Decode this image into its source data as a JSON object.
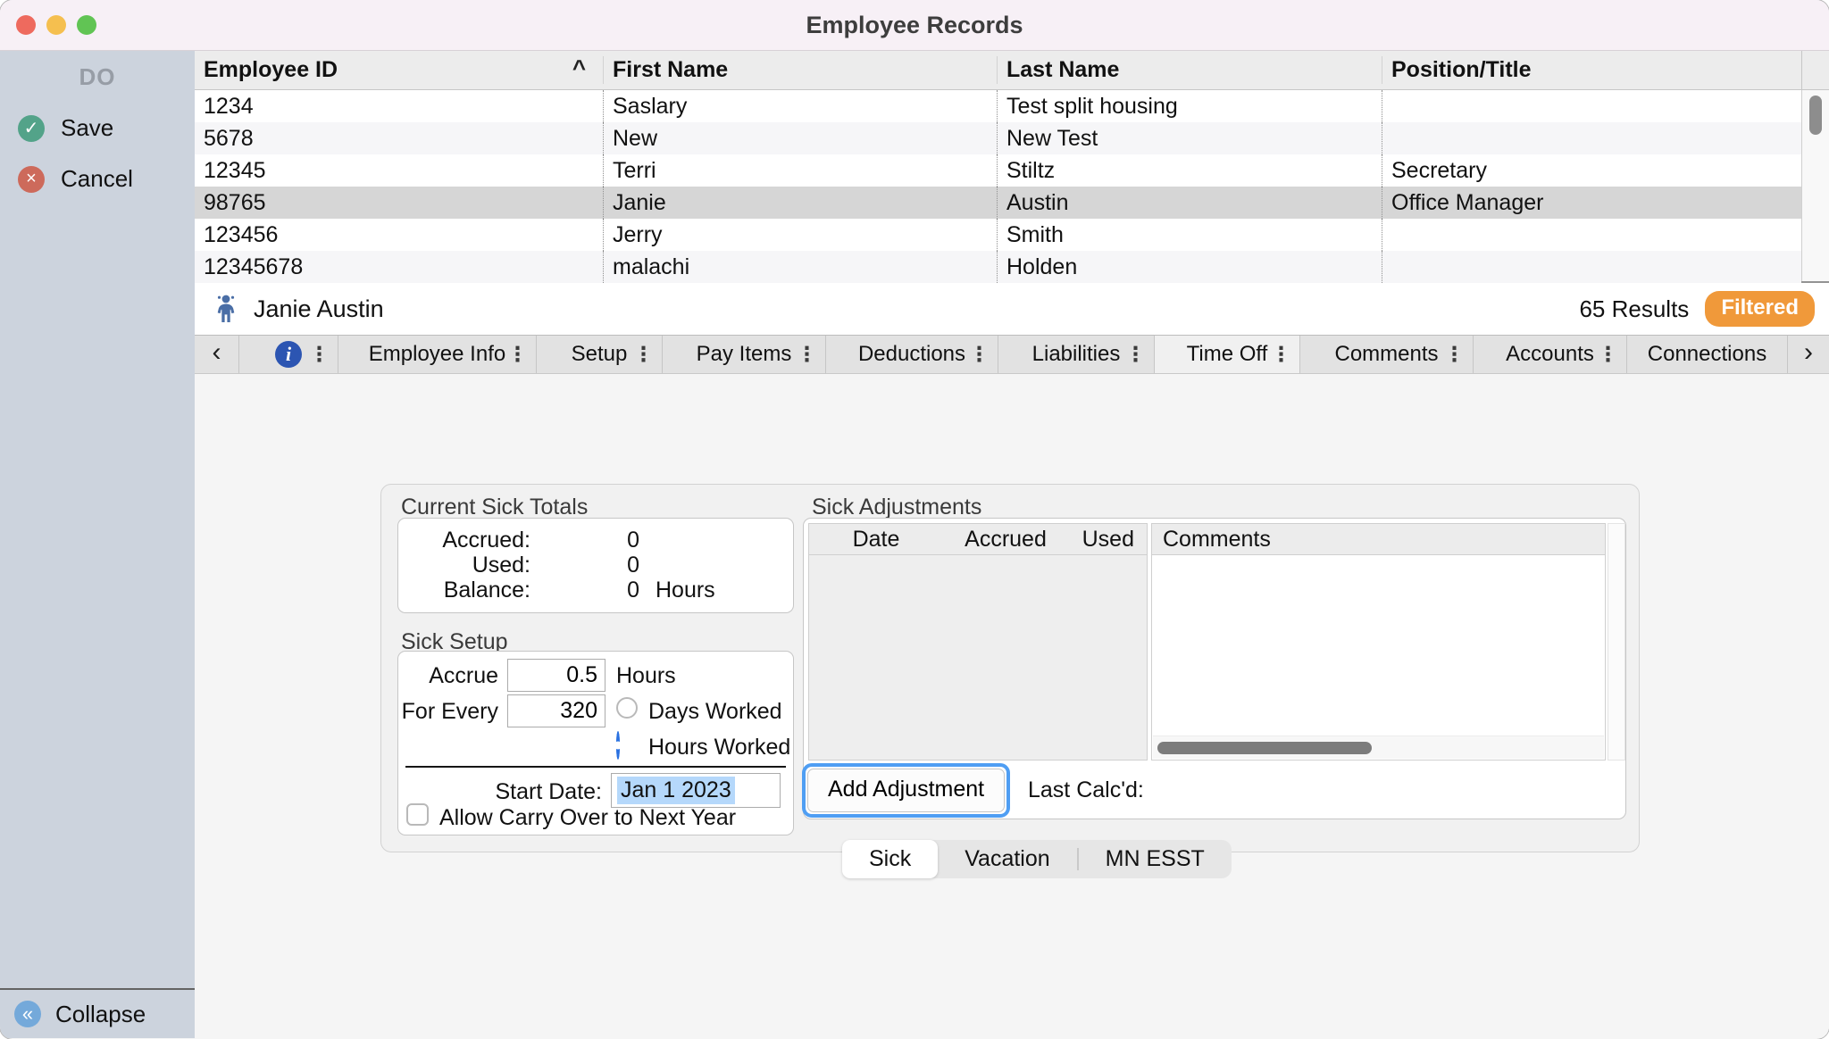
{
  "window": {
    "title": "Employee Records"
  },
  "sidebar": {
    "header": "DO",
    "save_label": "Save",
    "cancel_label": "Cancel",
    "collapse_label": "Collapse"
  },
  "icons": {
    "back_chevron": "‹",
    "forward_chevron": "›",
    "info": "i",
    "overflow_dots": "⋮",
    "sort_asc": "^",
    "save_check": "✓",
    "cancel_x": "×",
    "collapse_chevrons": "«",
    "person": "person-icon"
  },
  "employee_table": {
    "columns": [
      "Employee ID",
      "First Name",
      "Last Name",
      "Position/Title"
    ],
    "rows": [
      {
        "id": "1234",
        "first": "Saslary",
        "last": "Test split housing",
        "position": ""
      },
      {
        "id": "5678",
        "first": "New",
        "last": "New Test",
        "position": ""
      },
      {
        "id": "12345",
        "first": "Terri",
        "last": "Stiltz",
        "position": "Secretary"
      },
      {
        "id": "98765",
        "first": "Janie",
        "last": "Austin",
        "position": "Office Manager",
        "selected": true
      },
      {
        "id": "123456",
        "first": "Jerry",
        "last": "Smith",
        "position": ""
      },
      {
        "id": "12345678",
        "first": "malachi",
        "last": "Holden",
        "position": ""
      }
    ]
  },
  "record_bar": {
    "name": "Janie Austin",
    "results": "65 Results",
    "filter_badge": "Filtered"
  },
  "tabs": {
    "items": [
      "Employee Info",
      "Setup",
      "Pay Items",
      "Deductions",
      "Liabilities",
      "Time Off",
      "Comments",
      "Accounts",
      "Connections"
    ],
    "selected": "Time Off"
  },
  "time_off": {
    "totals": {
      "title": "Current Sick Totals",
      "rows": [
        {
          "label": "Accrued:",
          "value": "0",
          "unit": ""
        },
        {
          "label": "Used:",
          "value": "0",
          "unit": ""
        },
        {
          "label": "Balance:",
          "value": "0",
          "unit": "Hours"
        }
      ]
    },
    "setup": {
      "title": "Sick Setup",
      "accrue_label": "Accrue",
      "accrue_value": "0.5",
      "accrue_unit": "Hours",
      "for_every_label": "For Every",
      "for_every_value": "320",
      "radio_options": [
        {
          "label": "Days Worked",
          "selected": false
        },
        {
          "label": "Hours Worked",
          "selected": true
        }
      ],
      "start_date_label": "Start Date:",
      "start_date_value": "Jan 1 2023",
      "carry_over_label": "Allow Carry Over to Next Year",
      "carry_over_checked": false
    },
    "adjustments": {
      "title": "Sick Adjustments",
      "columns": [
        "Date",
        "Accrued",
        "Used",
        "Comments"
      ],
      "rows": [],
      "add_button": "Add Adjustment",
      "last_calcd_label": "Last Calc'd:"
    },
    "subtabs": [
      {
        "label": "Sick",
        "selected": true
      },
      {
        "label": "Vacation",
        "selected": false
      },
      {
        "label": "MN ESST",
        "selected": false
      }
    ]
  },
  "colors": {
    "filter_badge": "#f0993a",
    "info_icon_blue": "#2c55b2",
    "radio_blue": "#2e7cf6",
    "focus_ring_blue": "#4f9ef3",
    "text_selection": "#b5d8fb",
    "save_green": "#53a389",
    "cancel_red": "#cd6a5b",
    "collapse_blue": "#74a9da",
    "sidebar_bg": "#ccd3dd",
    "titlebar_bg": "#f7f0f6"
  }
}
